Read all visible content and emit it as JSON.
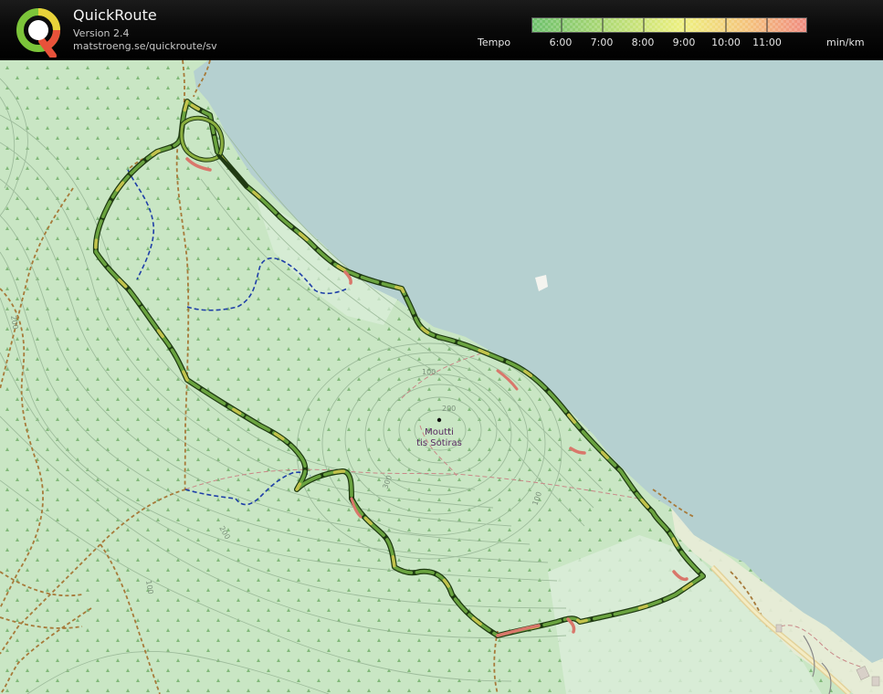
{
  "app": {
    "title": "QuickRoute",
    "version": "Version 2.4",
    "url": "matstroeng.se/quickroute/sv",
    "logo_icon": "quickroute-q-logo"
  },
  "pace_legend": {
    "title": "Tempo",
    "unit": "min/km",
    "ticks": [
      "6:00",
      "7:00",
      "8:00",
      "9:00",
      "10:00",
      "11:00"
    ],
    "gradient_colors": [
      "#6cc06c",
      "#b5dc75",
      "#eef07f",
      "#f4c47c",
      "#f08a80"
    ]
  },
  "map": {
    "sea_color": "#b5d0d0",
    "land_color": "#c9e6c4",
    "forest_color": "#a9d5a1",
    "contour_labels": [
      "100",
      "200",
      "300",
      "100",
      "200",
      "100",
      "200"
    ],
    "peak": {
      "name_line1": "Moutti",
      "name_line2": "tis Sotiras"
    },
    "route_colors": {
      "outline": "#1f3a12",
      "fast": "#6aa33f",
      "medium": "#c2c24c",
      "slow": "#d9776b"
    }
  }
}
